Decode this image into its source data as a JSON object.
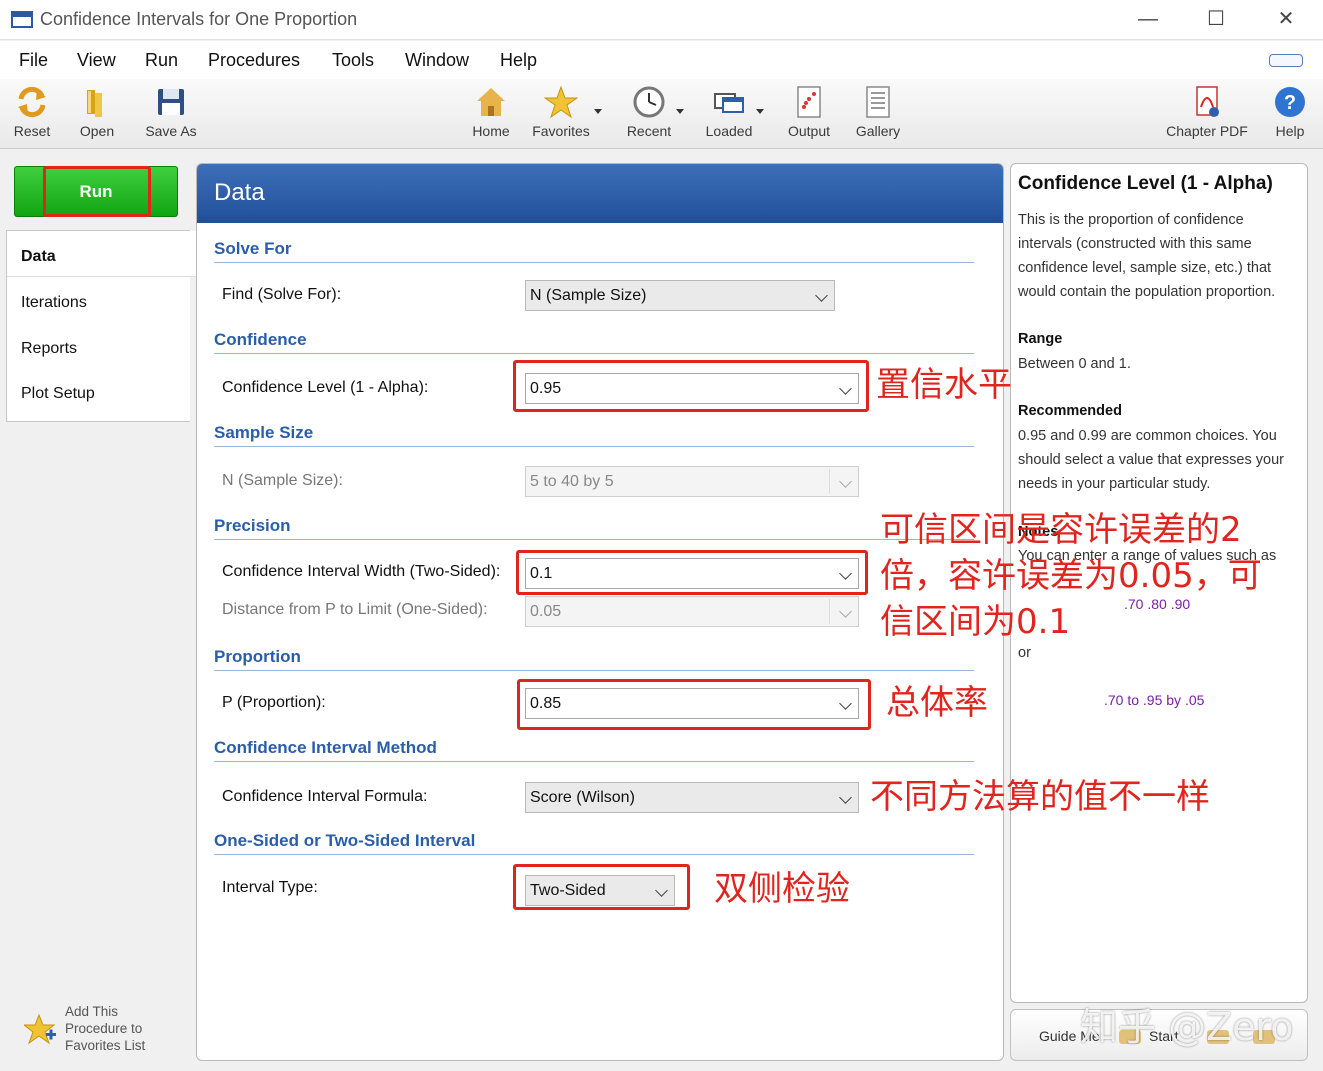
{
  "window": {
    "title": "Confidence Intervals for One Proportion"
  },
  "menu": [
    "File",
    "View",
    "Run",
    "Procedures",
    "Tools",
    "Window",
    "Help"
  ],
  "toolbar": {
    "reset": "Reset",
    "open": "Open",
    "save_as": "Save As",
    "home": "Home",
    "favorites": "Favorites",
    "recent": "Recent",
    "loaded": "Loaded",
    "output": "Output",
    "gallery": "Gallery",
    "chapter_pdf": "Chapter PDF",
    "help": "Help"
  },
  "sidebar": {
    "run_label": "Run",
    "tabs": [
      "Data",
      "Iterations",
      "Reports",
      "Plot Setup"
    ],
    "favorites_link": [
      "Add This",
      "Procedure to",
      "Favorites List"
    ]
  },
  "panel": {
    "header": "Data",
    "solve_for": {
      "title": "Solve For",
      "label": "Find (Solve For):",
      "value": "N (Sample Size)"
    },
    "confidence": {
      "title": "Confidence",
      "label": "Confidence Level (1 - Alpha):",
      "value": "0.95"
    },
    "sample_size": {
      "title": "Sample Size",
      "label": "N (Sample Size):",
      "value": "5 to 40 by 5"
    },
    "precision": {
      "title": "Precision",
      "width_label": "Confidence Interval Width (Two-Sided):",
      "width_value": "0.1",
      "distance_label": "Distance from P to Limit (One-Sided):",
      "distance_value": "0.05"
    },
    "proportion": {
      "title": "Proportion",
      "label": "P (Proportion):",
      "value": "0.85"
    },
    "method": {
      "title": "Confidence Interval Method",
      "label": "Confidence Interval Formula:",
      "value": "Score (Wilson)"
    },
    "sided": {
      "title": "One-Sided or Two-Sided Interval",
      "label": "Interval Type:",
      "value": "Two-Sided"
    }
  },
  "help": {
    "title": "Confidence Level (1 - Alpha)",
    "body": [
      "This is the proportion of confidence",
      "intervals (constructed with this same",
      "confidence level, sample size, etc.) that",
      "would contain the population proportion."
    ],
    "range_h": "Range",
    "range_text": "Between 0 and 1.",
    "recommended_h": "Recommended",
    "recommended_text": [
      "0.95 and 0.99 are common choices. You",
      "should select a value that expresses your",
      "needs in your particular study."
    ],
    "notes_h": "Notes",
    "notes_text": "You can enter a range of values such as",
    "example1": ".70 .80 .90",
    "or": "or",
    "example2": ".70 to .95 by .05",
    "guide_me": "Guide Me:",
    "start": "Start"
  },
  "annotations": {
    "confidence_note": "置信水平",
    "precision_note": [
      "可信区间是容许误差的2",
      "倍，容许误差为0.05，可",
      "信区间为0.1"
    ],
    "proportion_note": "总体率",
    "method_note": "不同方法算的值不一样",
    "sided_note": "双侧检验"
  },
  "watermark": "知乎 @Zero",
  "colors": {
    "annotation_red": "#e0251f",
    "header_blue": "#2f5fa8",
    "run_green": "#1fb01f",
    "section_blue": "#2b5ea8"
  }
}
